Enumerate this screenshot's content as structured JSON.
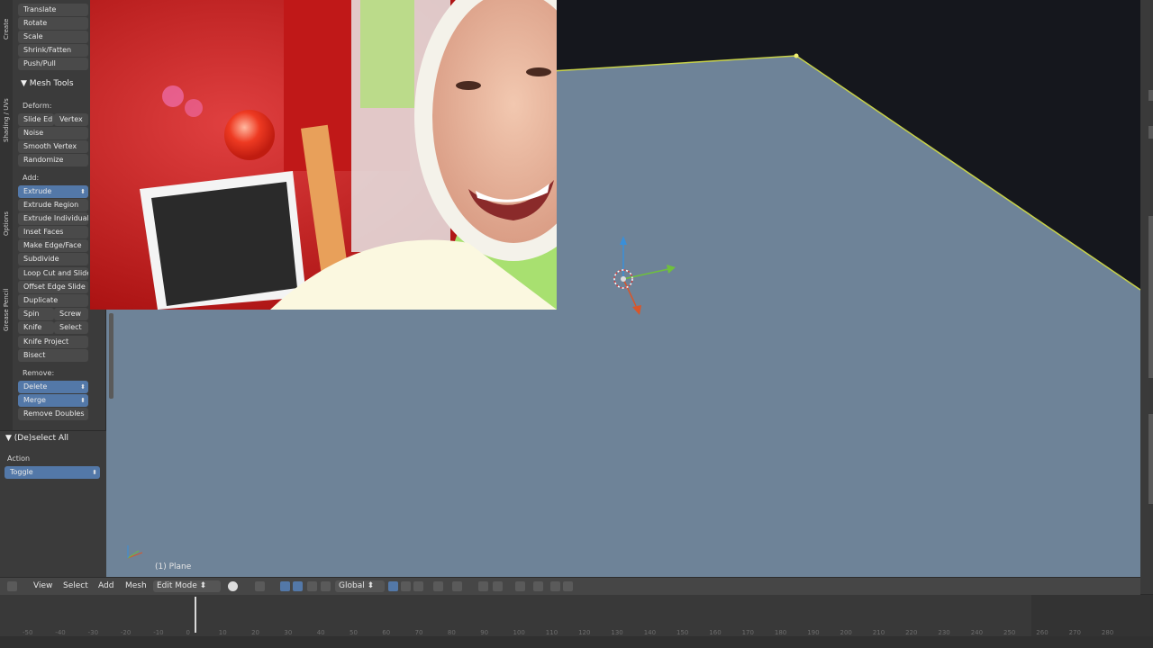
{
  "tool_shelf": {
    "tabs": [
      "Create",
      "Shading / UVs",
      "Options",
      "Grease Pencil"
    ],
    "transform": [
      "Translate",
      "Rotate",
      "Scale",
      "Shrink/Fatten",
      "Push/Pull"
    ],
    "mesh_tools_title": "Mesh Tools",
    "deform_label": "Deform:",
    "slide_edge": "Slide Ed",
    "vertex": "Vertex",
    "noise": "Noise",
    "smooth_vertex": "Smooth Vertex",
    "randomize": "Randomize",
    "add_label": "Add:",
    "extrude": "Extrude",
    "extrude_region": "Extrude Region",
    "extrude_individual": "Extrude Individual",
    "inset_faces": "Inset Faces",
    "make_edge_face": "Make Edge/Face",
    "subdivide": "Subdivide",
    "loop_cut": "Loop Cut and Slide",
    "offset_edge_slide": "Offset Edge Slide",
    "duplicate": "Duplicate",
    "spin": "Spin",
    "screw": "Screw",
    "knife": "Knife",
    "select": "Select",
    "knife_project": "Knife Project",
    "bisect": "Bisect",
    "remove_label": "Remove:",
    "delete": "Delete",
    "merge": "Merge",
    "remove_doubles": "Remove Doubles"
  },
  "operator_panel": {
    "title": "(De)select All",
    "action_label": "Action",
    "action_value": "Toggle"
  },
  "viewport": {
    "object_label": "(1) Plane",
    "background_color": "#6e8398"
  },
  "header": {
    "view": "View",
    "select": "Select",
    "add": "Add",
    "mesh": "Mesh",
    "mode": "Edit Mode",
    "orientation": "Global"
  },
  "timeline": {
    "ticks": [
      "-50",
      "-40",
      "-30",
      "-20",
      "-10",
      "0",
      "10",
      "20",
      "30",
      "40",
      "50",
      "60",
      "70",
      "80",
      "90",
      "100",
      "110",
      "120",
      "130",
      "140",
      "150",
      "160",
      "170",
      "180",
      "190",
      "200",
      "210",
      "220",
      "230",
      "240",
      "250",
      "260",
      "270",
      "280"
    ]
  },
  "icons": [
    "triangle-down-icon",
    "transform-manipulator-icon",
    "3d-cursor-icon",
    "axis-gizmo-icon",
    "sphere-shading-icon",
    "pivot-icon",
    "vertex-select-icon",
    "edge-select-icon",
    "face-select-icon",
    "snap-icon",
    "render-icon"
  ]
}
